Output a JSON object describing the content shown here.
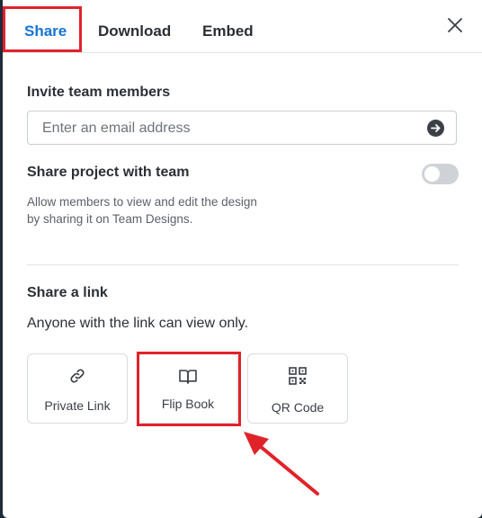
{
  "tabs": [
    {
      "label": "Share",
      "active": true
    },
    {
      "label": "Download",
      "active": false
    },
    {
      "label": "Embed",
      "active": false
    }
  ],
  "invite": {
    "title": "Invite team members",
    "email_placeholder": "Enter an email address",
    "email_value": ""
  },
  "share_project": {
    "title": "Share project with team",
    "toggle_on": false,
    "description_line1": "Allow members to view and edit the design",
    "description_line2": "by sharing it on Team Designs."
  },
  "share_link": {
    "title": "Share a link",
    "subtext": "Anyone with the link can view only.",
    "options": [
      {
        "label": "Private Link",
        "icon": "link-icon"
      },
      {
        "label": "Flip Book",
        "icon": "book-icon"
      },
      {
        "label": "QR Code",
        "icon": "qr-code-icon"
      }
    ]
  },
  "colors": {
    "accent": "#1673d6",
    "highlight": "#e0232a",
    "toggle_off": "#cfd3d8"
  }
}
